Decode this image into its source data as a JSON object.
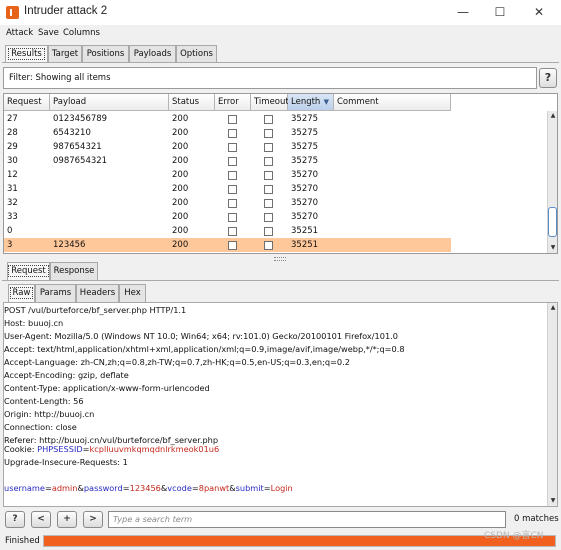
{
  "window": {
    "title": "Intruder attack 2",
    "controls": {
      "minimize": "—",
      "maximize": "☐",
      "close": "✕"
    }
  },
  "menu": [
    "Attack",
    "Save",
    "Columns"
  ],
  "main_tabs": [
    "Results",
    "Target",
    "Positions",
    "Payloads",
    "Options"
  ],
  "selected_main_tab": "Results",
  "filter": {
    "text": "Filter: Showing all items",
    "help_label": "?"
  },
  "results_table": {
    "columns": [
      "Request",
      "Payload",
      "Status",
      "Error",
      "Timeout",
      "Length",
      "Comment"
    ],
    "sorted_column": "Length",
    "sort_direction": "descending",
    "rows": [
      {
        "request": "27",
        "payload": "0123456789",
        "status": "200",
        "error": false,
        "timeout": false,
        "length": "35275",
        "comment": ""
      },
      {
        "request": "28",
        "payload": "6543210",
        "status": "200",
        "error": false,
        "timeout": false,
        "length": "35275",
        "comment": ""
      },
      {
        "request": "29",
        "payload": "987654321",
        "status": "200",
        "error": false,
        "timeout": false,
        "length": "35275",
        "comment": ""
      },
      {
        "request": "30",
        "payload": "0987654321",
        "status": "200",
        "error": false,
        "timeout": false,
        "length": "35275",
        "comment": ""
      },
      {
        "request": "12",
        "payload": "",
        "status": "200",
        "error": false,
        "timeout": false,
        "length": "35270",
        "comment": ""
      },
      {
        "request": "31",
        "payload": "",
        "status": "200",
        "error": false,
        "timeout": false,
        "length": "35270",
        "comment": ""
      },
      {
        "request": "32",
        "payload": "",
        "status": "200",
        "error": false,
        "timeout": false,
        "length": "35270",
        "comment": ""
      },
      {
        "request": "33",
        "payload": "",
        "status": "200",
        "error": false,
        "timeout": false,
        "length": "35270",
        "comment": ""
      },
      {
        "request": "0",
        "payload": "",
        "status": "200",
        "error": false,
        "timeout": false,
        "length": "35251",
        "comment": ""
      },
      {
        "request": "3",
        "payload": "123456",
        "status": "200",
        "error": false,
        "timeout": false,
        "length": "35251",
        "comment": ""
      }
    ],
    "selected_row_request": "3",
    "selected_row_color": "#ffc89a"
  },
  "detail_tabs": [
    "Request",
    "Response"
  ],
  "selected_detail_tab": "Request",
  "view_tabs": [
    "Raw",
    "Params",
    "Headers",
    "Hex"
  ],
  "selected_view_tab": "Raw",
  "raw_request": {
    "lines": [
      "POST /vul/burteforce/bf_server.php HTTP/1.1",
      "Host: buuoj.cn",
      "User-Agent: Mozilla/5.0 (Windows NT 10.0; Win64; x64; rv:101.0) Gecko/20100101 Firefox/101.0",
      "Accept: text/html,application/xhtml+xml,application/xml;q=0.9,image/avif,image/webp,*/*;q=0.8",
      "Accept-Language: zh-CN,zh;q=0.8,zh-TW;q=0.7,zh-HK;q=0.5,en-US;q=0.3,en;q=0.2",
      "Accept-Encoding: gzip, deflate",
      "Content-Type: application/x-www-form-urlencoded",
      "Content-Length: 56",
      "Origin: http://buuoj.cn",
      "Connection: close",
      "Referer: http://buuoj.cn/vul/burteforce/bf_server.php"
    ],
    "cookie_prefix": "Cookie: ",
    "cookie_name": "PHPSESSID",
    "cookie_eq": "=",
    "cookie_value": "kcplluuvmkqmqdnlrkmeok01u6",
    "upgrade_line": "Upgrade-Insecure-Requests: 1",
    "body_parts": [
      {
        "text": "username",
        "kind": "name"
      },
      {
        "text": "=",
        "kind": "plain"
      },
      {
        "text": "admin",
        "kind": "value"
      },
      {
        "text": "&",
        "kind": "plain"
      },
      {
        "text": "password",
        "kind": "name"
      },
      {
        "text": "=",
        "kind": "plain"
      },
      {
        "text": "123456",
        "kind": "value"
      },
      {
        "text": "&",
        "kind": "plain"
      },
      {
        "text": "vcode",
        "kind": "name"
      },
      {
        "text": "=",
        "kind": "plain"
      },
      {
        "text": "8panwt",
        "kind": "value"
      },
      {
        "text": "&",
        "kind": "plain"
      },
      {
        "text": "submit",
        "kind": "name"
      },
      {
        "text": "=",
        "kind": "plain"
      },
      {
        "text": "Login",
        "kind": "value"
      }
    ],
    "param_name_color": "#2a2ac6",
    "param_value_color": "#c4281c"
  },
  "search": {
    "help_label": "?",
    "prev_label": "<",
    "add_label": "+",
    "next_label": ">",
    "placeholder": "Type a search term",
    "matches": "0 matches"
  },
  "status": {
    "label": "Finished",
    "progress": 1.0,
    "progress_color": "#f2601f"
  },
  "watermark": "CSDN @言CN"
}
